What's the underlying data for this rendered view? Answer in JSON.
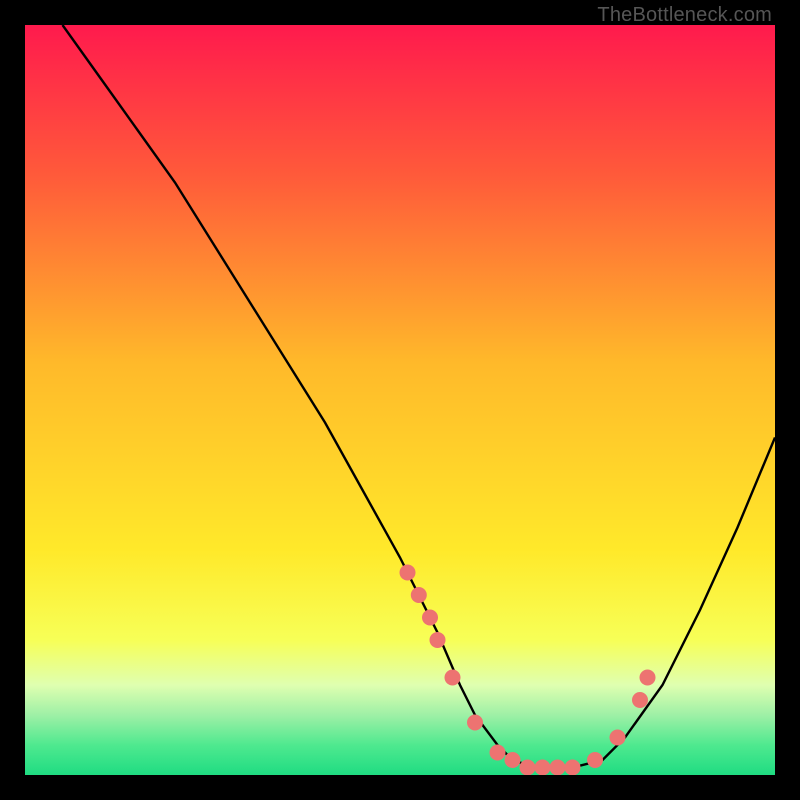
{
  "watermark": "TheBottleneck.com",
  "chart_data": {
    "type": "line",
    "title": "",
    "xlabel": "",
    "ylabel": "",
    "xlim": [
      0,
      100
    ],
    "ylim": [
      0,
      100
    ],
    "curve": {
      "name": "bottleneck-curve",
      "x": [
        5,
        10,
        15,
        20,
        25,
        30,
        35,
        40,
        45,
        50,
        55,
        58,
        60,
        63,
        65,
        68,
        70,
        73,
        77,
        80,
        85,
        90,
        95,
        100
      ],
      "y": [
        100,
        93,
        86,
        79,
        71,
        63,
        55,
        47,
        38,
        29,
        19,
        12,
        8,
        4,
        2,
        1,
        1,
        1,
        2,
        5,
        12,
        22,
        33,
        45
      ]
    },
    "points": {
      "name": "sample-points",
      "color": "#ed7371",
      "x": [
        51,
        52.5,
        54,
        55,
        57,
        60,
        63,
        65,
        67,
        69,
        71,
        73,
        76,
        79,
        82,
        83
      ],
      "y": [
        27,
        24,
        21,
        18,
        13,
        7,
        3,
        2,
        1,
        1,
        1,
        1,
        2,
        5,
        10,
        13
      ]
    },
    "background_gradient": {
      "type": "vertical",
      "stops": [
        {
          "pos": 0.0,
          "color": "#ff1a4d"
        },
        {
          "pos": 0.2,
          "color": "#ff5a3a"
        },
        {
          "pos": 0.45,
          "color": "#ffb92a"
        },
        {
          "pos": 0.7,
          "color": "#ffe92a"
        },
        {
          "pos": 0.82,
          "color": "#f7ff57"
        },
        {
          "pos": 0.88,
          "color": "#dfffb0"
        },
        {
          "pos": 0.92,
          "color": "#9ef0a6"
        },
        {
          "pos": 0.96,
          "color": "#4fe98f"
        },
        {
          "pos": 1.0,
          "color": "#1fdc82"
        }
      ]
    }
  }
}
